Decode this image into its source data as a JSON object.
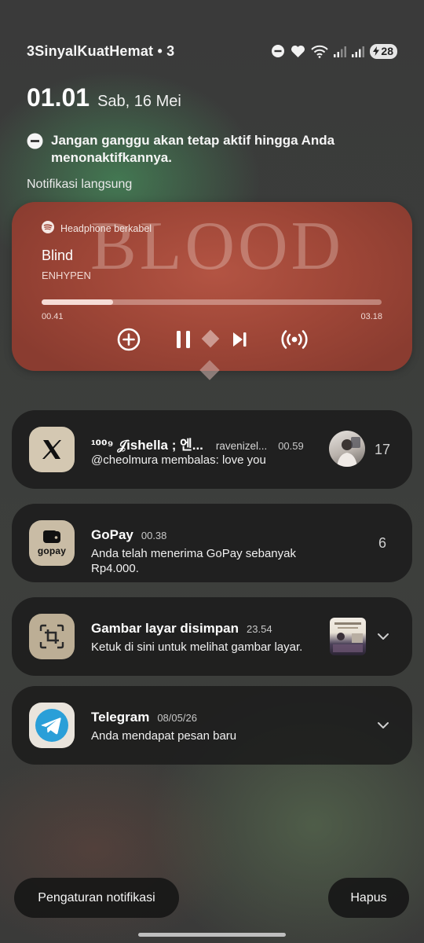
{
  "status_bar": {
    "carrier": "3SinyalKuatHemat • 3",
    "battery_level": "28",
    "icons": [
      "do-not-disturb-icon",
      "heart-icon",
      "wifi-icon",
      "signal-icon",
      "signal-icon",
      "battery-icon"
    ]
  },
  "header": {
    "time": "01.01",
    "date": "Sab, 16 Mei",
    "dnd_message": "Jangan ganggu akan tetap aktif hingga Anda menonaktifkannya.",
    "live_label": "Notifikasi langsung"
  },
  "media": {
    "source": "Headphone berkabel",
    "background_word": "BLOOD",
    "title": "Blind",
    "artist": "ENHYPEN",
    "elapsed": "00.41",
    "total": "03.18",
    "progress_fraction": 0.21,
    "accent": "#a24a3b"
  },
  "notifications": [
    {
      "app": "X",
      "title": "¹⁰⁰⁹ 𝒥ishella ; 엔...",
      "sender": "ravenizel...",
      "time": "00.59",
      "body": "@cheolmura membalas: love you",
      "count": "17",
      "icon": "x-logo-icon"
    },
    {
      "app": "GoPay",
      "title": "GoPay",
      "time": "00.38",
      "body": "Anda telah menerima GoPay sebanyak Rp4.000.",
      "count": "6",
      "icon_text": "gopay"
    },
    {
      "app": "Screenshot",
      "title": "Gambar layar disimpan",
      "time": "23.54",
      "body": "Ketuk di sini untuk melihat gambar layar.",
      "icon": "screenshot-crop-icon"
    },
    {
      "app": "Telegram",
      "title": "Telegram",
      "time": "08/05/26",
      "body": "Anda mendapat pesan baru",
      "icon": "telegram-icon"
    }
  ],
  "footer": {
    "settings_label": "Pengaturan notifikasi",
    "clear_label": "Hapus"
  }
}
